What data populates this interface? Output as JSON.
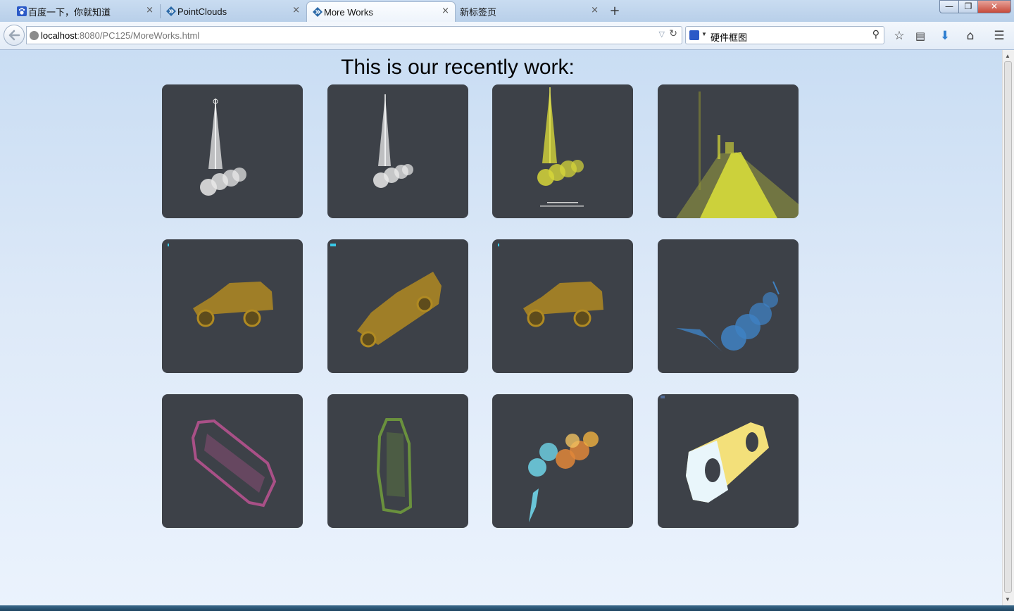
{
  "browser": {
    "tabs": [
      {
        "title": "百度一下，你就知道",
        "icon": "baidu-paw-icon",
        "active": false
      },
      {
        "title": "PointClouds",
        "icon": "diamond-arrow-icon",
        "active": false
      },
      {
        "title": "More Works",
        "icon": "diamond-arrow-icon",
        "active": true
      },
      {
        "title": "新标签页",
        "icon": "",
        "active": false
      }
    ],
    "new_tab_symbol": "+",
    "close_symbol": "×",
    "window_controls": {
      "minimize": "—",
      "maximize": "❐",
      "close": "✕"
    },
    "url_host": "localhost",
    "url_rest": ":8080/PC125/MoreWorks.html",
    "search_query": "硬件框图",
    "toolbar_icons": [
      "bookmark-star-icon",
      "reader-list-icon",
      "downloads-arrow-icon",
      "home-icon",
      "menu-icon"
    ]
  },
  "page": {
    "title": "This is our recently work:",
    "gallery": [
      {
        "subject": "tree-point-cloud",
        "color": "#e9e9e9"
      },
      {
        "subject": "tree-point-cloud",
        "color": "#e9e9e9"
      },
      {
        "subject": "tree-point-cloud",
        "color": "#d6d63a"
      },
      {
        "subject": "road-point-cloud",
        "color": "#e4e83a"
      },
      {
        "subject": "car-point-cloud",
        "color": "#b08a22"
      },
      {
        "subject": "car-point-cloud",
        "color": "#b08a22"
      },
      {
        "subject": "car-point-cloud",
        "color": "#b08a22"
      },
      {
        "subject": "tree-point-cloud",
        "color": "#3f82c4"
      },
      {
        "subject": "car-point-cloud",
        "color": "#b5528e"
      },
      {
        "subject": "car-point-cloud",
        "color": "#6f9a3c"
      },
      {
        "subject": "tree-point-cloud",
        "color": "#6fd4e8"
      },
      {
        "subject": "car-point-cloud",
        "color": "#f3e07a"
      }
    ]
  },
  "colors": {
    "tile_bg": "#3d4148",
    "page_bg_top": "#c9ddf3",
    "page_bg_bottom": "#ebf3fd"
  }
}
